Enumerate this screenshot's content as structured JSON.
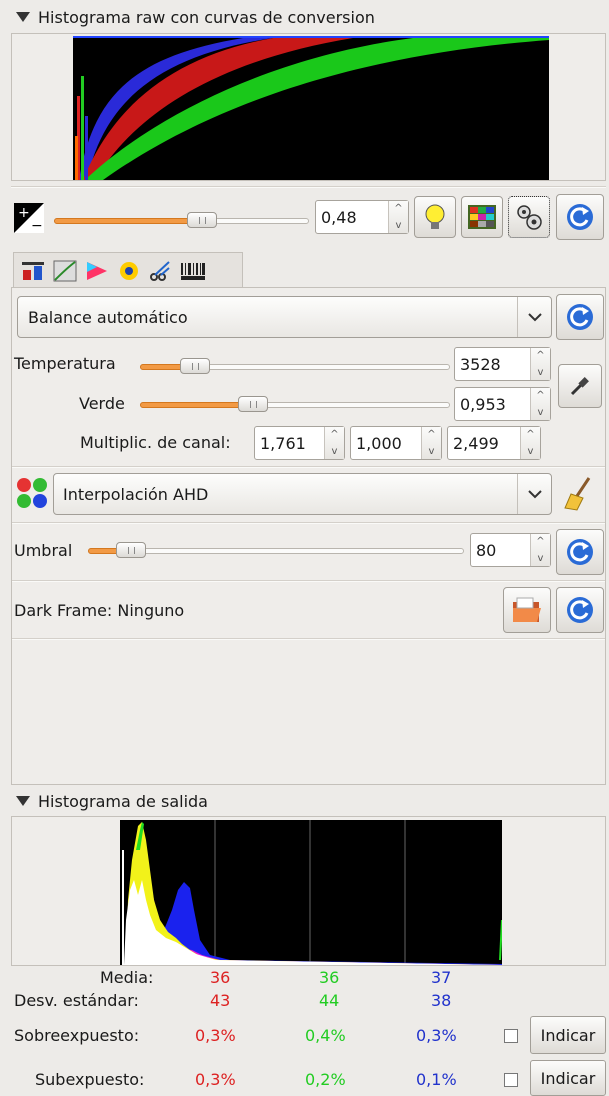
{
  "raw_section": {
    "title": "Histograma raw con curvas de conversion",
    "exposure_value": "0,48",
    "exposure_fraction": 0.47
  },
  "tabs": [
    "wb-tab-icon",
    "curve-tab-icon",
    "color-tab-icon",
    "lens-tab-icon",
    "crop-tab-icon",
    "exif-tab-icon"
  ],
  "white_balance": {
    "mode": "Balance automático",
    "temperature_label": "Temperatura",
    "temperature_value": "3528",
    "temperature_fraction": 0.13,
    "green_label": "Verde",
    "green_value": "0,953",
    "green_fraction": 0.35,
    "multipliers_label": "Multiplic. de canal:",
    "multipliers": [
      "1,761",
      "1,000",
      "2,499"
    ]
  },
  "interpolation": {
    "mode": "Interpolación AHD"
  },
  "threshold": {
    "label": "Umbral",
    "value": "80",
    "fraction": 0.11
  },
  "darkframe": {
    "label": "Dark Frame: Ninguno"
  },
  "output_section": {
    "title": "Histograma de salida",
    "stats": {
      "mean_label": "Media:",
      "mean": [
        "36",
        "36",
        "37"
      ],
      "stddev_label": "Desv. estándar:",
      "stddev": [
        "43",
        "44",
        "38"
      ],
      "over_label": "Sobreexpuesto:",
      "over": [
        "0,3%",
        "0,4%",
        "0,3%"
      ],
      "under_label": "Subexpuesto:",
      "under": [
        "0,3%",
        "0,2%",
        "0,1%"
      ]
    },
    "indicate_label": "Indicar"
  },
  "colors": {
    "red": "#dd2222",
    "green": "#22cc22",
    "blue": "#2233cc",
    "accent": "#f29a45"
  }
}
